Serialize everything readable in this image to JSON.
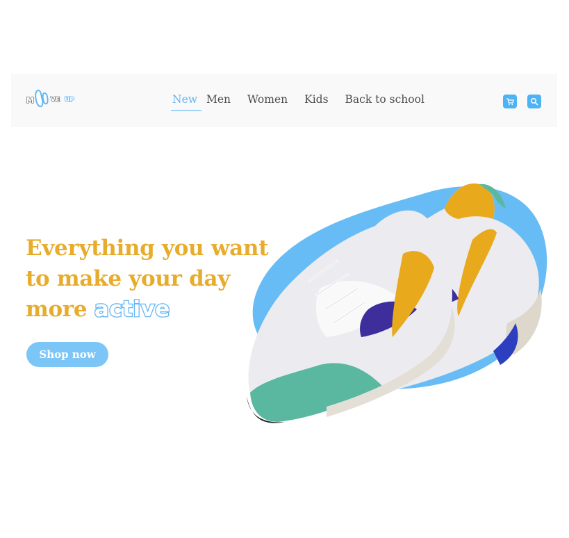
{
  "brand": {
    "logo_alt": "MOVE UP",
    "primary_color": "#63b6f4",
    "accent_color": "#e8ac2c"
  },
  "nav": {
    "items": [
      {
        "label": "New",
        "active": true
      },
      {
        "label": "Men",
        "active": false
      },
      {
        "label": "Women",
        "active": false
      },
      {
        "label": "Kids",
        "active": false
      },
      {
        "label": "Back to school",
        "active": false
      }
    ]
  },
  "header_icons": {
    "cart": "cart-icon",
    "search": "search-icon"
  },
  "hero": {
    "line1": "Everything you want",
    "line2": "to make your day",
    "line3_prefix": "more",
    "highlight": "active",
    "cta_label": "Shop now"
  }
}
